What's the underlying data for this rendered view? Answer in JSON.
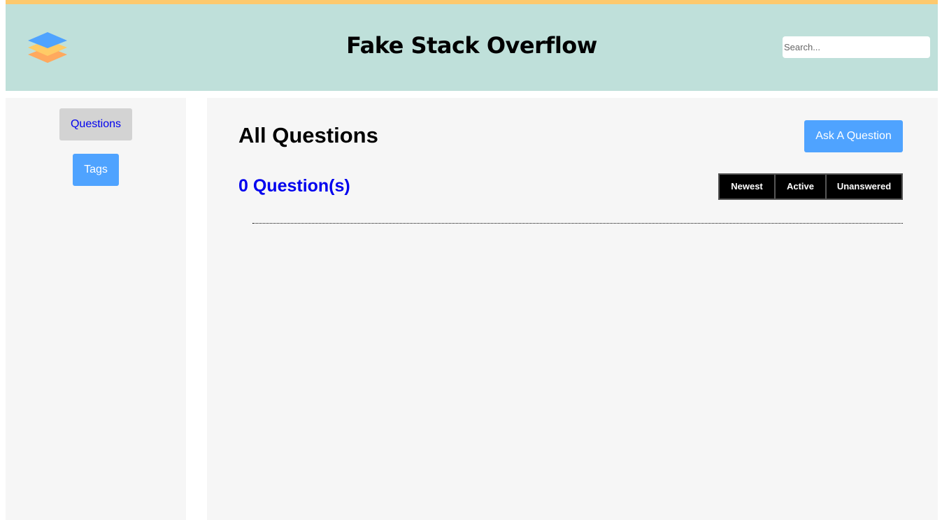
{
  "header": {
    "title": "Fake Stack Overflow",
    "logo_icon": "stacked-layers-icon",
    "search_placeholder": "Search...",
    "search_value": ""
  },
  "sidebar": {
    "items": [
      {
        "label": "Questions",
        "selected": true
      },
      {
        "label": "Tags",
        "selected": false
      }
    ]
  },
  "main": {
    "title": "All Questions",
    "ask_button": "Ask A Question",
    "count_label": "0 Question(s)",
    "sort_buttons": [
      "Newest",
      "Active",
      "Unanswered"
    ]
  },
  "colors": {
    "header_bg": "#bfe0da",
    "header_accent": "#fdc96d",
    "primary_button": "#4fa3ff",
    "selected_nav": "#d3d3d3",
    "link_blue": "#0000ee",
    "panel_bg": "#f6f6f6"
  }
}
